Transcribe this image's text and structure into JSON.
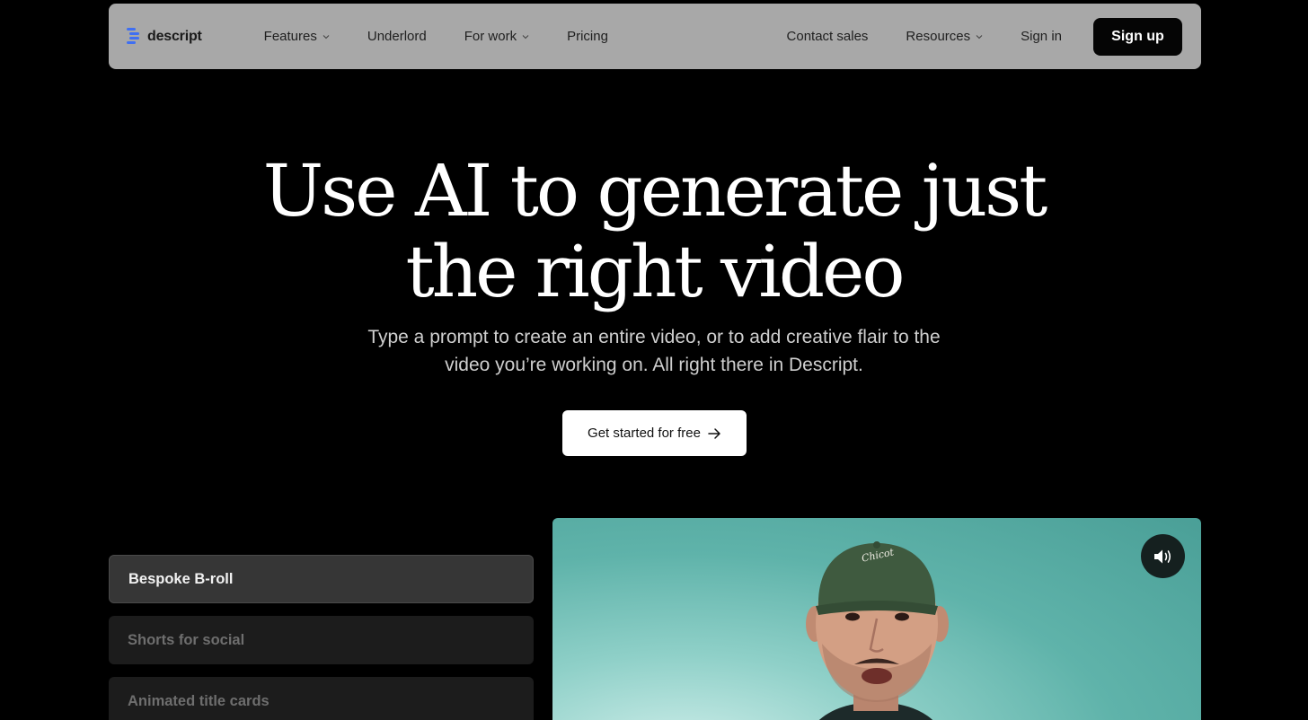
{
  "nav": {
    "logo_text": "descript",
    "left_items": [
      {
        "label": "Features",
        "has_dropdown": true
      },
      {
        "label": "Underlord",
        "has_dropdown": false
      },
      {
        "label": "For work",
        "has_dropdown": true
      },
      {
        "label": "Pricing",
        "has_dropdown": false
      }
    ],
    "right_items": [
      {
        "label": "Contact sales",
        "has_dropdown": false
      },
      {
        "label": "Resources",
        "has_dropdown": true
      },
      {
        "label": "Sign in",
        "has_dropdown": false
      }
    ],
    "signup_label": "Sign up"
  },
  "hero": {
    "title_line1": "Use AI to generate just",
    "title_line2": "the right video",
    "subtitle_line1": "Type a prompt to create an entire video, or to add creative flair to the",
    "subtitle_line2": "video you’re working on. All right there in Descript.",
    "cta_label": "Get started for free"
  },
  "tabs": [
    {
      "label": "Bespoke B-roll",
      "active": true
    },
    {
      "label": "Shorts for social",
      "active": false
    },
    {
      "label": "Animated title cards",
      "active": false
    }
  ],
  "video": {
    "cap_text": "Chicot",
    "sound_icon": "speaker-volume-icon"
  },
  "colors": {
    "background": "#000000",
    "nav_bg": "#a8a8a8",
    "signup_bg": "#050505",
    "logo_accent": "#3f6ff2",
    "video_bg": "#5fb3aa"
  }
}
